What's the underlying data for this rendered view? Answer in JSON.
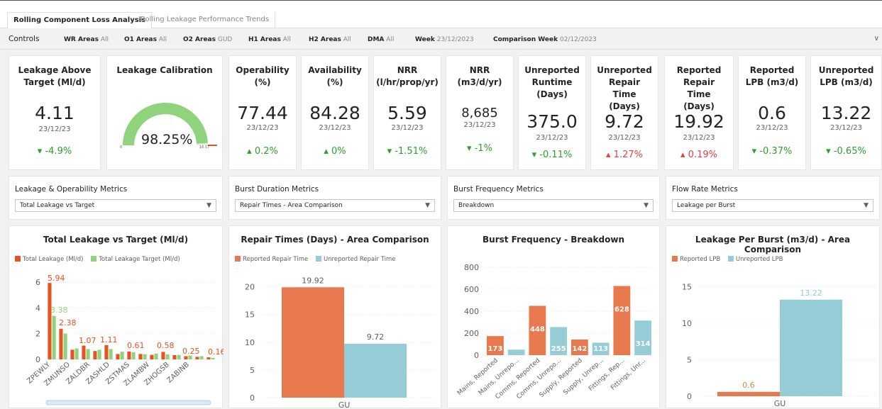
{
  "tabs": [
    {
      "label": "Rolling Component Loss Analysis",
      "active": true
    },
    {
      "label": "Rolling Leakage Performance Trends",
      "active": false
    }
  ],
  "controls": {
    "title": "Controls",
    "filters": [
      {
        "label": "WR Areas",
        "value": "All"
      },
      {
        "label": "O1 Areas",
        "value": "All"
      },
      {
        "label": "O2 Areas",
        "value": "GUD"
      },
      {
        "label": "H1 Areas",
        "value": "All"
      },
      {
        "label": "H2 Areas",
        "value": "All"
      },
      {
        "label": "DMA",
        "value": "All"
      },
      {
        "label": "Week",
        "value": "23/12/2023"
      },
      {
        "label": "Comparison Week",
        "value": "02/12/2023"
      }
    ]
  },
  "kpis": [
    {
      "title": "Leakage Above Target (Ml/d)",
      "value": "4.11",
      "date": "23/12/23",
      "change": "-4.9%",
      "dir": "down",
      "status": "good"
    },
    {
      "title": "Leakage Calibration",
      "gauge_value": "98.25%",
      "gauge_fraction": 0.9825,
      "gauge_min": "0",
      "gauge_max": "16.17"
    },
    {
      "title": "Operability (%)",
      "value": "77.44",
      "date": "23/12/23",
      "change": "0.2%",
      "dir": "up",
      "status": "good"
    },
    {
      "title": "Availability (%)",
      "value": "84.28",
      "date": "23/12/23",
      "change": "0%",
      "dir": "up",
      "status": "good"
    },
    {
      "title": "NRR (l/hr/prop/yr)",
      "value": "5.59",
      "date": "23/12/23",
      "change": "-1.51%",
      "dir": "down",
      "status": "good"
    },
    {
      "title": "NRR (m3/d/yr)",
      "value": "8,685",
      "date": "23/12/23",
      "change": "-1%",
      "dir": "down",
      "status": "good"
    },
    {
      "title": "Unreported Runtime (Days)",
      "value": "375.0",
      "date": "23/12/23",
      "change": "-0.11%",
      "dir": "down",
      "status": "good"
    },
    {
      "title": "Unreported Repair Time (Days)",
      "value": "9.72",
      "date": "23/12/23",
      "change": "1.27%",
      "dir": "up",
      "status": "bad"
    },
    {
      "title": "Reported Repair Time (Days)",
      "value": "19.92",
      "date": "23/12/23",
      "change": "0.19%",
      "dir": "up",
      "status": "bad"
    },
    {
      "title": "Reported LPB (m3/d)",
      "value": "0.6",
      "date": "23/12/23",
      "change": "-0.37%",
      "dir": "down",
      "status": "good"
    },
    {
      "title": "Unreported LPB (m3/d)",
      "value": "13.22",
      "date": "23/12/23",
      "change": "-0.65%",
      "dir": "down",
      "status": "good"
    }
  ],
  "selectors": [
    {
      "label": "Leakage & Operability Metrics",
      "value": "Total Leakage vs Target"
    },
    {
      "label": "Burst Duration Metrics",
      "value": "Repair Times - Area Comparison"
    },
    {
      "label": "Burst Frequency Metrics",
      "value": "Breakdown"
    },
    {
      "label": "Flow Rate Metrics",
      "value": "Leakage per Burst"
    }
  ],
  "colors": {
    "orange": "#e8784e",
    "green": "#8fd37c",
    "teal": "#95ccd6",
    "darkorange": "#e6531f",
    "good": "#2ca02c",
    "bad": "#d64541"
  },
  "chart_data": [
    {
      "type": "bar",
      "title": "Total Leakage vs Target (Ml/d)",
      "series": [
        {
          "name": "Total Leakage (Ml/d)",
          "values": [
            5.94,
            2.38,
            0.75,
            1.07,
            0.65,
            1.11,
            0.42,
            0.61,
            0.42,
            0.35,
            0.58,
            0.33,
            0.25,
            0.2,
            0.16
          ]
        },
        {
          "name": "Total Leakage Target (Ml/d)",
          "values": [
            3.38,
            2.0,
            0.85,
            0.8,
            0.75,
            0.8,
            0.6,
            0.55,
            0.4,
            0.45,
            0.4,
            0.35,
            0.3,
            0.25,
            0.12
          ]
        }
      ],
      "categories": [
        "ZPEWLY",
        "ZMUNSO",
        "ZALDBR",
        "ZASHLD",
        "ZSTMAS",
        "ZLAMBW",
        "ZHOGSB",
        "ZABINB"
      ],
      "data_labels": [
        "5.94",
        "3.38",
        "2.38",
        "1.07",
        "1.11",
        "0.61",
        "0.58",
        "0.25",
        "0.16"
      ],
      "yticks": [
        "0",
        "2",
        "4",
        "6"
      ],
      "ylim": [
        0,
        6.5
      ]
    },
    {
      "type": "bar",
      "title": "Repair Times (Days) - Area Comparison",
      "categories": [
        "GU"
      ],
      "series": [
        {
          "name": "Reported Repair Time",
          "values": [
            19.92
          ]
        },
        {
          "name": "Unreported Repair Time",
          "values": [
            9.72
          ]
        }
      ],
      "yticks": [
        "0",
        "5",
        "10",
        "15",
        "20"
      ],
      "ylim": [
        0,
        22
      ]
    },
    {
      "type": "bar",
      "title": "Burst Frequency - Breakdown",
      "categories": [
        "Mains, Reported",
        "Mains, Unrepo...",
        "Comms, Reported",
        "Comms, Unrepo...",
        "Supply, Reported",
        "Supply, Unrep...",
        "Fittings, Rep...",
        "Fittings, Unr..."
      ],
      "values": [
        173,
        50,
        448,
        255,
        142,
        113,
        628,
        314
      ],
      "bar_colors": [
        "orange",
        "teal",
        "orange",
        "teal",
        "orange",
        "teal",
        "orange",
        "teal"
      ],
      "data_labels": [
        "173",
        "",
        "448",
        "255",
        "142",
        "113",
        "628",
        "314"
      ],
      "yticks": [
        "0",
        "200",
        "400",
        "600",
        "800"
      ],
      "ylim": [
        0,
        850
      ]
    },
    {
      "type": "bar",
      "title": "Leakage Per Burst (m3/d) - Area Comparison",
      "categories": [
        "GU"
      ],
      "series": [
        {
          "name": "Reported LPB",
          "values": [
            0.6
          ]
        },
        {
          "name": "Unreported LPB",
          "values": [
            13.22
          ]
        }
      ],
      "yticks": [
        "0",
        "5",
        "10",
        "15"
      ],
      "ylim": [
        0,
        16.5
      ]
    }
  ]
}
